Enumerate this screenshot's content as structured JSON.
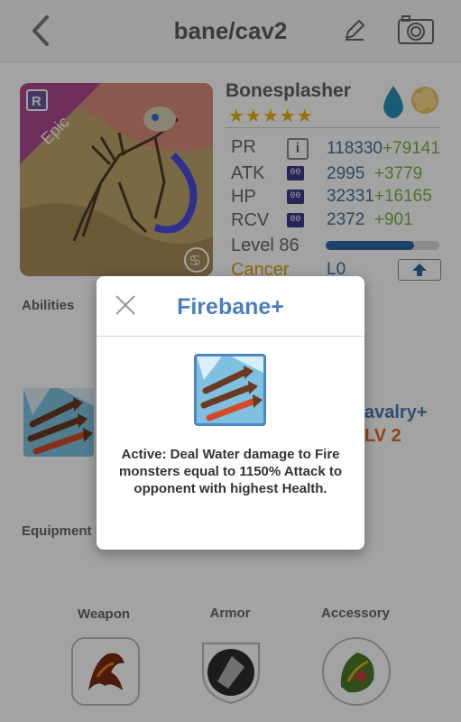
{
  "header": {
    "title": "bane/cav2",
    "back_icon": "chevron-left-icon",
    "edit_icon": "pencil-icon",
    "camera_icon": "camera-icon"
  },
  "monster": {
    "name": "Bonesplasher",
    "rarity": "Epic",
    "rank_badge": "R",
    "stars": "★★★★★",
    "star_count": 5,
    "elements": [
      "water-drop-icon",
      "cloud-icon"
    ],
    "stats": [
      {
        "label": "PR",
        "value": "118330",
        "bonus": "+79141"
      },
      {
        "label": "ATK",
        "value": "2995",
        "bonus": "+3779",
        "badge": "00"
      },
      {
        "label": "HP",
        "value": "32331",
        "bonus": "+16165",
        "badge": "00"
      },
      {
        "label": "RCV",
        "value": "2372",
        "bonus": "+901",
        "badge": "00"
      }
    ],
    "level_label": "Level 86",
    "level_progress": 0.78,
    "sign": "Cancer",
    "sign_level": "L0"
  },
  "sections": {
    "abilities": "Abilities",
    "equipment": "Equipment"
  },
  "ability": {
    "name": "avalry+",
    "level": "LV 2"
  },
  "equipment": [
    {
      "label": "Weapon",
      "icon": "claw-weapon-icon"
    },
    {
      "label": "Armor",
      "icon": "shield-armor-icon"
    },
    {
      "label": "Accessory",
      "icon": "leaf-accessory-icon"
    }
  ],
  "popup": {
    "title": "Firebane+",
    "description": "Active: Deal Water damage to Fire monsters equal to 1150% Attack to opponent with highest Health.",
    "close_icon": "close-icon"
  },
  "colors": {
    "accent": "#4a7fbd",
    "epic_banner": "#b04a8f",
    "bonus_green": "#7cb242",
    "level_orange": "#e06a1b",
    "stars": "#e8b400"
  }
}
